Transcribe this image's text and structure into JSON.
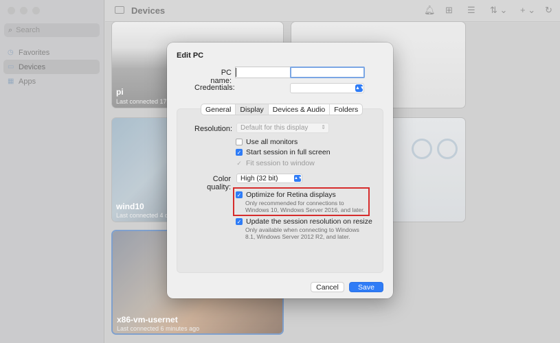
{
  "window": {
    "title": "Devices"
  },
  "sidebar": {
    "search_placeholder": "Search",
    "items": [
      {
        "label": "Favorites",
        "icon": "clock-icon"
      },
      {
        "label": "Devices",
        "icon": "display-icon",
        "active": true
      },
      {
        "label": "Apps",
        "icon": "apps-icon"
      }
    ]
  },
  "devices": [
    {
      "name": "pi",
      "status": "Last connected 17 mi"
    },
    {
      "name": "wind10",
      "status": "Last connected 4 da"
    },
    {
      "name": "x86-vm-usernet",
      "status": "Last connected 6 minutes ago"
    }
  ],
  "dialog": {
    "title": "Edit PC",
    "pc_name_label": "PC name:",
    "pc_name_value": "",
    "credentials_label": "Credentials:",
    "credentials_value": "",
    "tabs": [
      "General",
      "Display",
      "Devices & Audio",
      "Folders"
    ],
    "active_tab": "Display",
    "resolution_label": "Resolution:",
    "resolution_value": "Default for this display",
    "use_all_monitors": "Use all monitors",
    "start_full_screen": "Start session in full screen",
    "fit_session": "Fit session to window",
    "color_quality_label": "Color quality:",
    "color_quality_value": "High (32 bit)",
    "optimize_retina": "Optimize for Retina displays",
    "optimize_retina_note": "Only recommended for connections to Windows 10, Windows Server 2016, and later.",
    "update_resolution": "Update the session resolution on resize",
    "update_resolution_note": "Only available when connecting to Windows 8.1, Windows Server 2012 R2, and later.",
    "cancel_label": "Cancel",
    "save_label": "Save"
  },
  "state": {
    "use_all_monitors": false,
    "start_full_screen": true,
    "fit_session": true,
    "optimize_retina": true,
    "update_resolution": true
  },
  "colors": {
    "accent": "#2f7cf6",
    "highlight": "#d62b2b"
  }
}
